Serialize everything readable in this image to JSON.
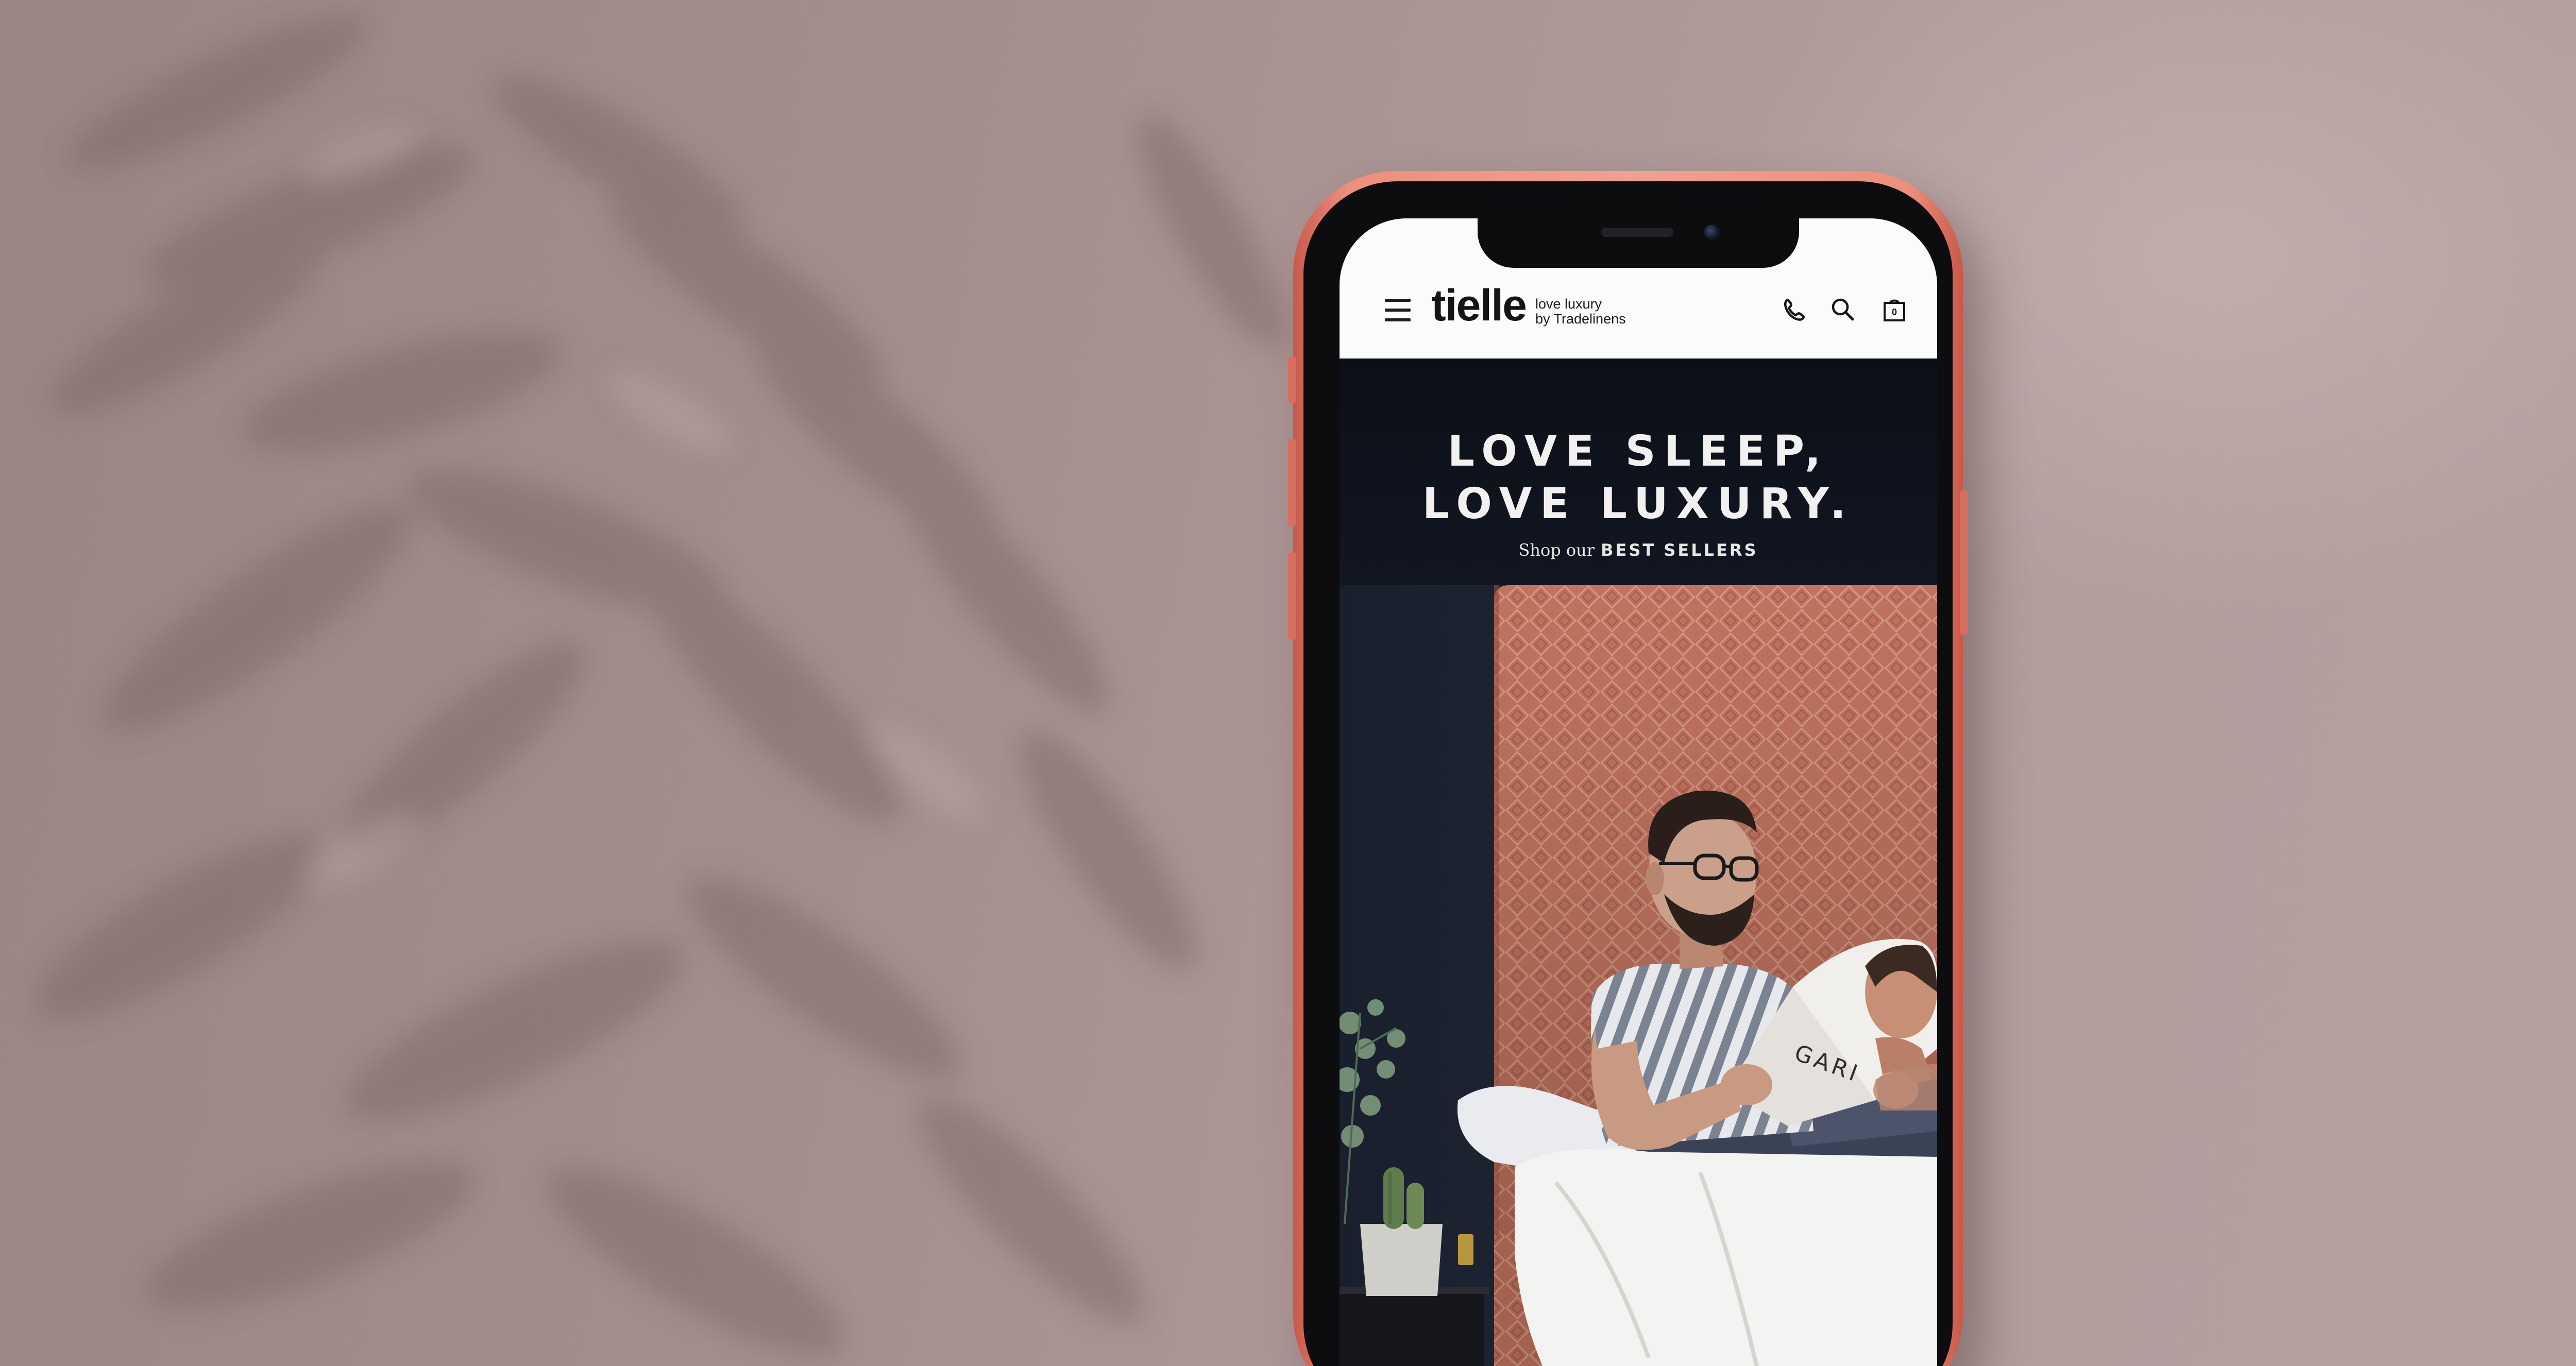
{
  "brand": {
    "name": "tielle",
    "tagline_line1": "love luxury",
    "tagline_line2": "by Tradelinens"
  },
  "header": {
    "icons": [
      "menu-icon",
      "phone-icon",
      "search-icon",
      "bag-icon"
    ],
    "cart_count": "0"
  },
  "hero": {
    "title_line1": "LOVE SLEEP,",
    "title_line2": "LOVE LUXURY.",
    "cta_prefix": "Shop our",
    "cta_label": "BEST SELLERS",
    "magazine_text": "GARI"
  },
  "colors": {
    "wall": "#a8908f",
    "phone_frame": "#ee8f7d",
    "header_bg": "#fbfbfa",
    "hero_bg": "#141925",
    "headboard": "#c0735f"
  }
}
